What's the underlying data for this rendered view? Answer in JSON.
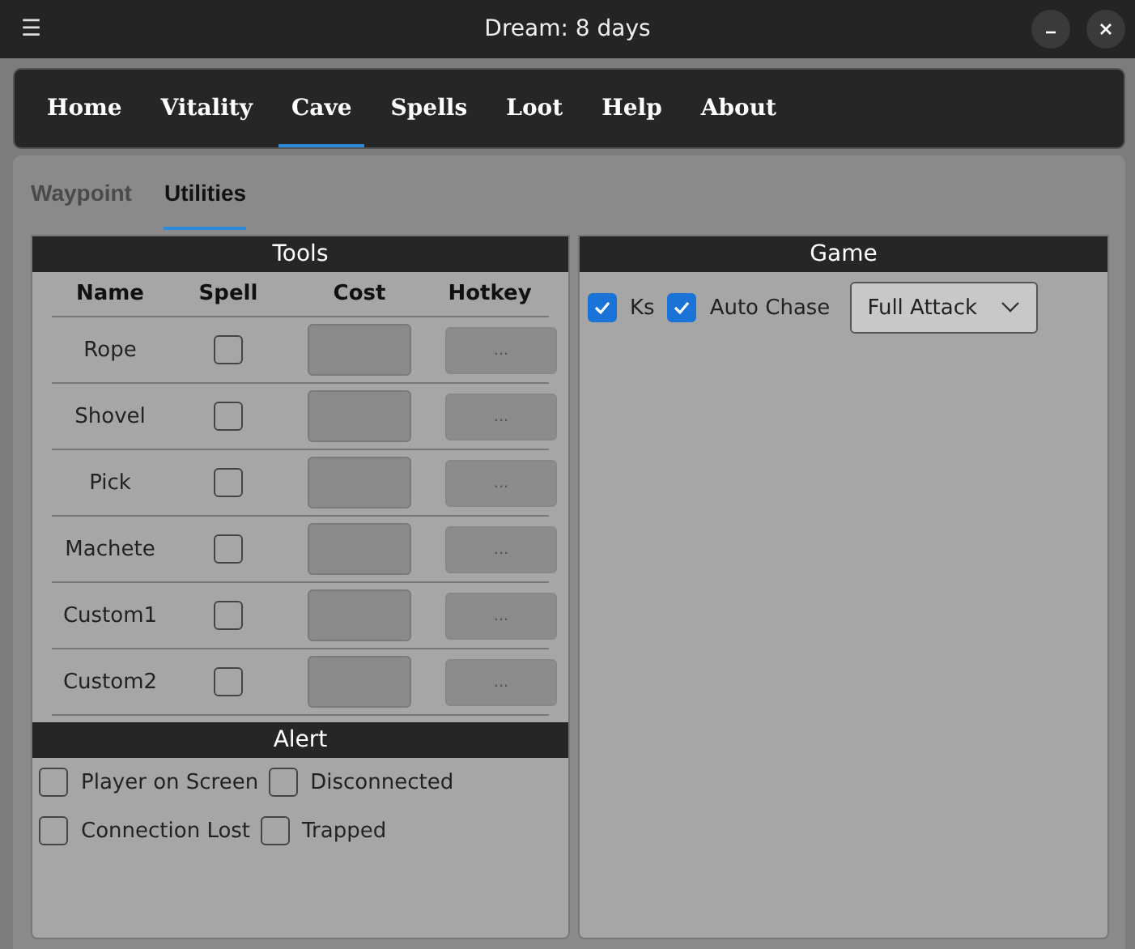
{
  "window": {
    "title": "Dream: 8 days",
    "menu_icon": "☰"
  },
  "nav_tabs": [
    {
      "label": "Home",
      "selected": false
    },
    {
      "label": "Vitality",
      "selected": false
    },
    {
      "label": "Cave",
      "selected": true
    },
    {
      "label": "Spells",
      "selected": false
    },
    {
      "label": "Loot",
      "selected": false
    },
    {
      "label": "Help",
      "selected": false
    },
    {
      "label": "About",
      "selected": false
    }
  ],
  "sub_tabs": [
    {
      "label": "Waypoint",
      "selected": false
    },
    {
      "label": "Utilities",
      "selected": true
    }
  ],
  "tools": {
    "title": "Tools",
    "columns": [
      "Name",
      "Spell",
      "Cost",
      "Hotkey"
    ],
    "rows": [
      {
        "name": "Rope",
        "spell": false,
        "hotkey": "..."
      },
      {
        "name": "Shovel",
        "spell": false,
        "hotkey": "..."
      },
      {
        "name": "Pick",
        "spell": false,
        "hotkey": "..."
      },
      {
        "name": "Machete",
        "spell": false,
        "hotkey": "..."
      },
      {
        "name": "Custom1",
        "spell": false,
        "hotkey": "..."
      },
      {
        "name": "Custom2",
        "spell": false,
        "hotkey": "..."
      }
    ]
  },
  "alert": {
    "title": "Alert",
    "options": [
      {
        "label": "Player on Screen",
        "checked": false
      },
      {
        "label": "Disconnected",
        "checked": false
      },
      {
        "label": "Connection Lost",
        "checked": false
      },
      {
        "label": "Trapped",
        "checked": false
      }
    ]
  },
  "game": {
    "title": "Game",
    "options": [
      {
        "label": "Ks",
        "checked": true
      },
      {
        "label": "Auto Chase",
        "checked": true
      }
    ],
    "mode": "Full Attack"
  }
}
